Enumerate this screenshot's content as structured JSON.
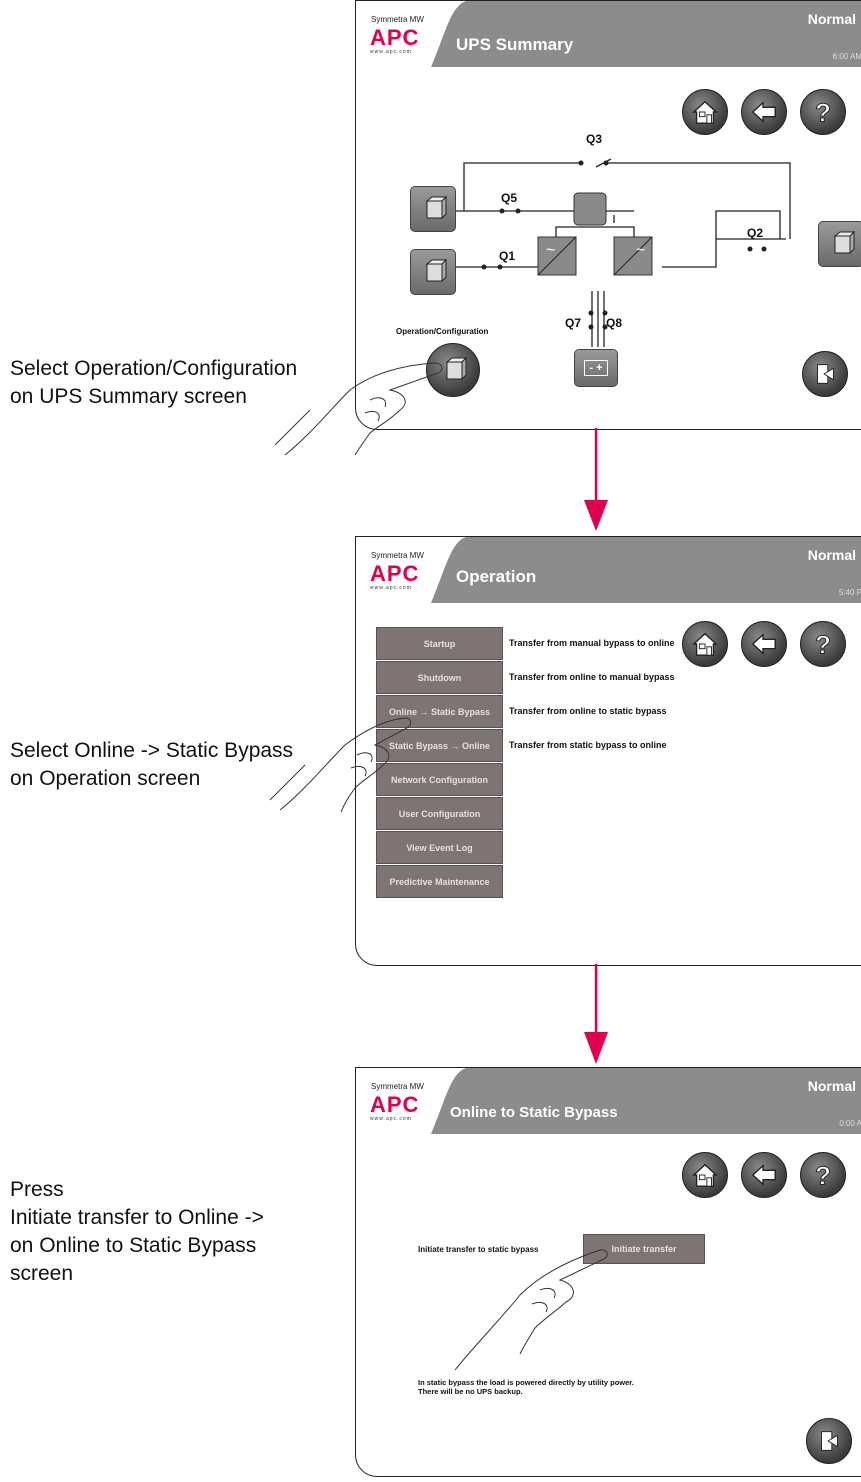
{
  "captions": {
    "step1": [
      "Select Operation/Configuration",
      "on UPS Summary screen"
    ],
    "step2": [
      "Select Online -> Static Bypass",
      "on Operation screen"
    ],
    "step3": [
      "Press",
      "Initiate transfer to Online ->",
      "on Online to Static Bypass",
      "screen"
    ]
  },
  "brand": {
    "product": "Symmetra MW",
    "logo": "APC",
    "url": "www.apc.com"
  },
  "screen1": {
    "title": "UPS Summary",
    "status": "Normal",
    "time": "6:00 AM",
    "breakers": {
      "q3": "Q3",
      "q5": "Q5",
      "q1": "Q1",
      "q2": "Q2",
      "q7": "Q7",
      "q8": "Q8"
    },
    "op_config_label": "Operation/Configuration",
    "battery_symbol": "- +"
  },
  "screen2": {
    "title": "Operation",
    "status": "Normal",
    "time": "5:40 P",
    "buttons": [
      {
        "label": "Startup",
        "desc": "Transfer from manual bypass to online"
      },
      {
        "label": "Shutdown",
        "desc": "Transfer from online to manual bypass"
      },
      {
        "label": "Online → Static Bypass",
        "desc": "Transfer from online to static bypass"
      },
      {
        "label": "Static Bypass → Online",
        "desc": "Transfer from static bypass to online"
      },
      {
        "label": "Network Configuration",
        "desc": ""
      },
      {
        "label": "User Configuration",
        "desc": ""
      },
      {
        "label": "View Event Log",
        "desc": ""
      },
      {
        "label": "Predictive Maintenance",
        "desc": ""
      }
    ]
  },
  "screen3": {
    "title": "Online to Static Bypass",
    "status": "Normal",
    "time": "0:00 A",
    "initiate_label": "Initiate transfer to static bypass",
    "initiate_button": "Initiate transfer",
    "note_line1": "In static bypass the load is powered directly by utility power.",
    "note_line2": "There will be no UPS backup."
  },
  "colors": {
    "accent": "#e0004f",
    "header_gray": "#8c8c8c",
    "button": "#7f7474"
  }
}
